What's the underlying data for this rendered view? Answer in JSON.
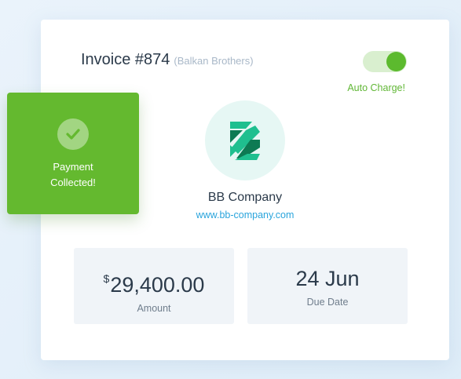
{
  "invoice": {
    "title": "Invoice #874",
    "client": "(Balkan Brothers)",
    "auto_charge_label": "Auto Charge!",
    "auto_charge_enabled": true
  },
  "company": {
    "name": "BB Company",
    "url": "www.bb-company.com",
    "logo_icon": "bb-company-logo-icon"
  },
  "stats": {
    "amount": {
      "currency": "$",
      "value": "29,400.00",
      "label": "Amount"
    },
    "due_date": {
      "value": "24 Jun",
      "label": "Due Date"
    }
  },
  "payment_badge": {
    "line1": "Payment",
    "line2": "Collected!",
    "icon": "checkmark-icon"
  },
  "colors": {
    "accent_green": "#64b92f",
    "toggle_track": "#d9efcf",
    "link_blue": "#29a4dc",
    "logo_green": "#1fbf8f",
    "logo_dark_green": "#0d7a53"
  }
}
